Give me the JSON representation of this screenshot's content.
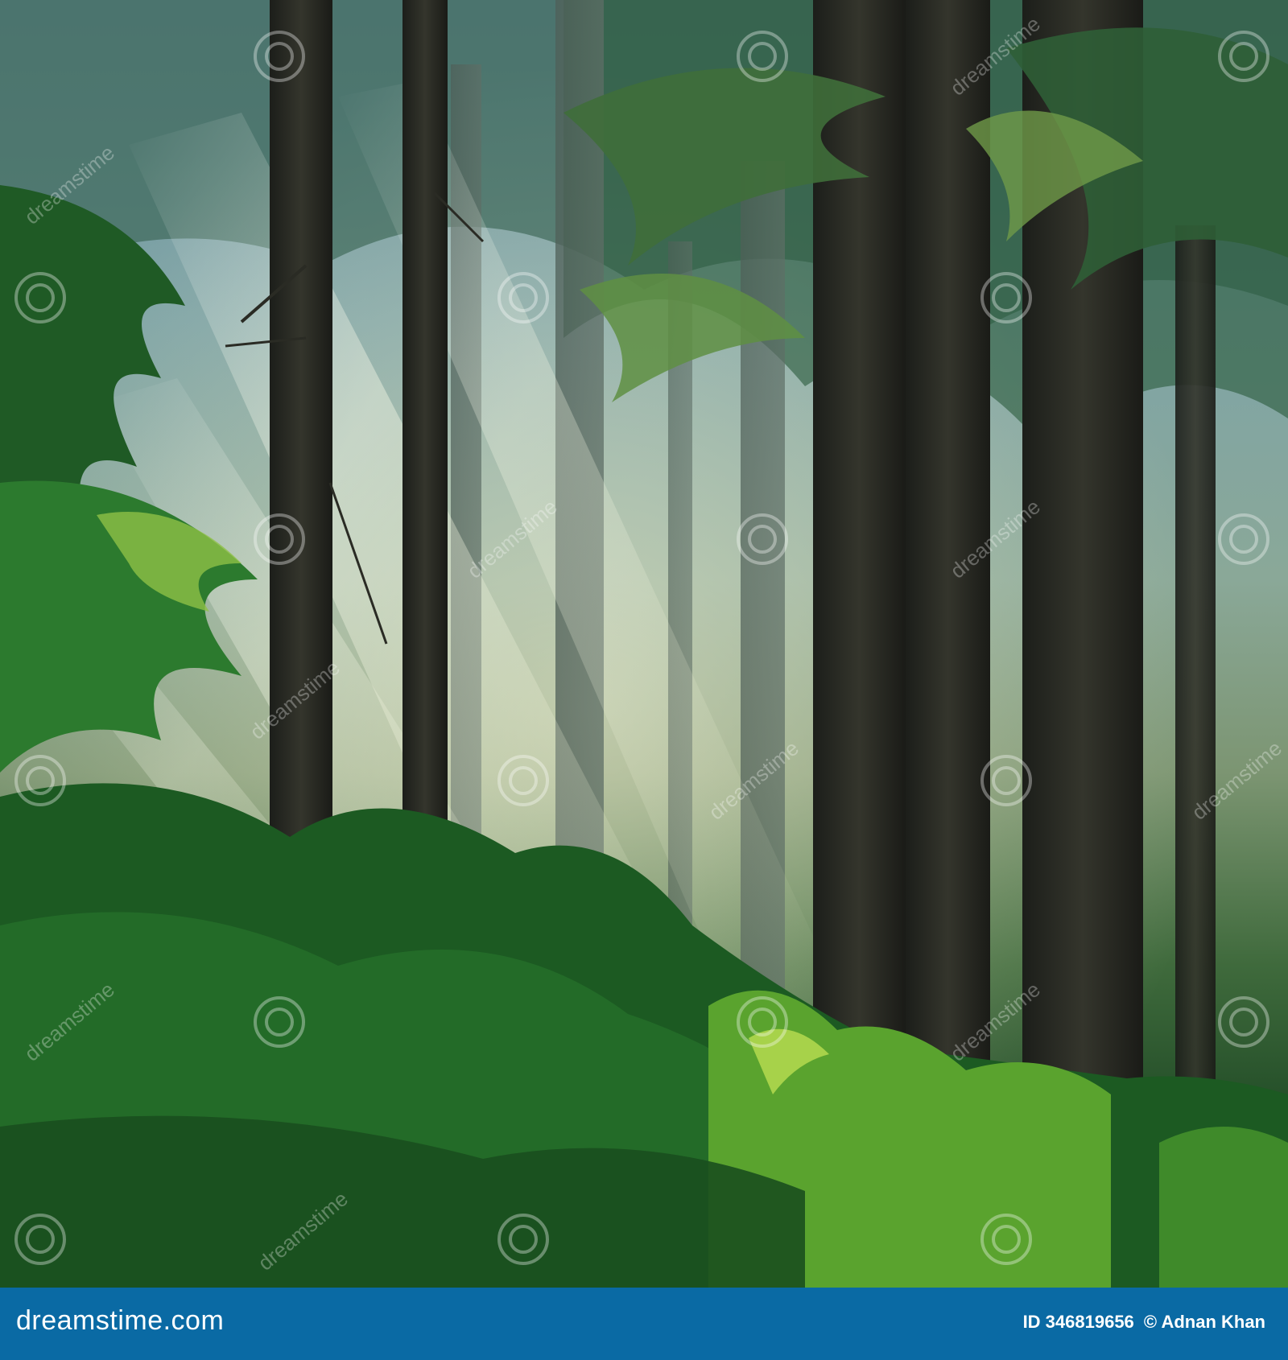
{
  "photo": {
    "subject": "misty forest"
  },
  "watermark": {
    "text": "dreamstime"
  },
  "footer": {
    "brand": "dreamstime.com",
    "image_id": "ID 346819656",
    "author": "Adnan Khan",
    "copyright_symbol": "©",
    "background_color": "#0a6aa4"
  }
}
